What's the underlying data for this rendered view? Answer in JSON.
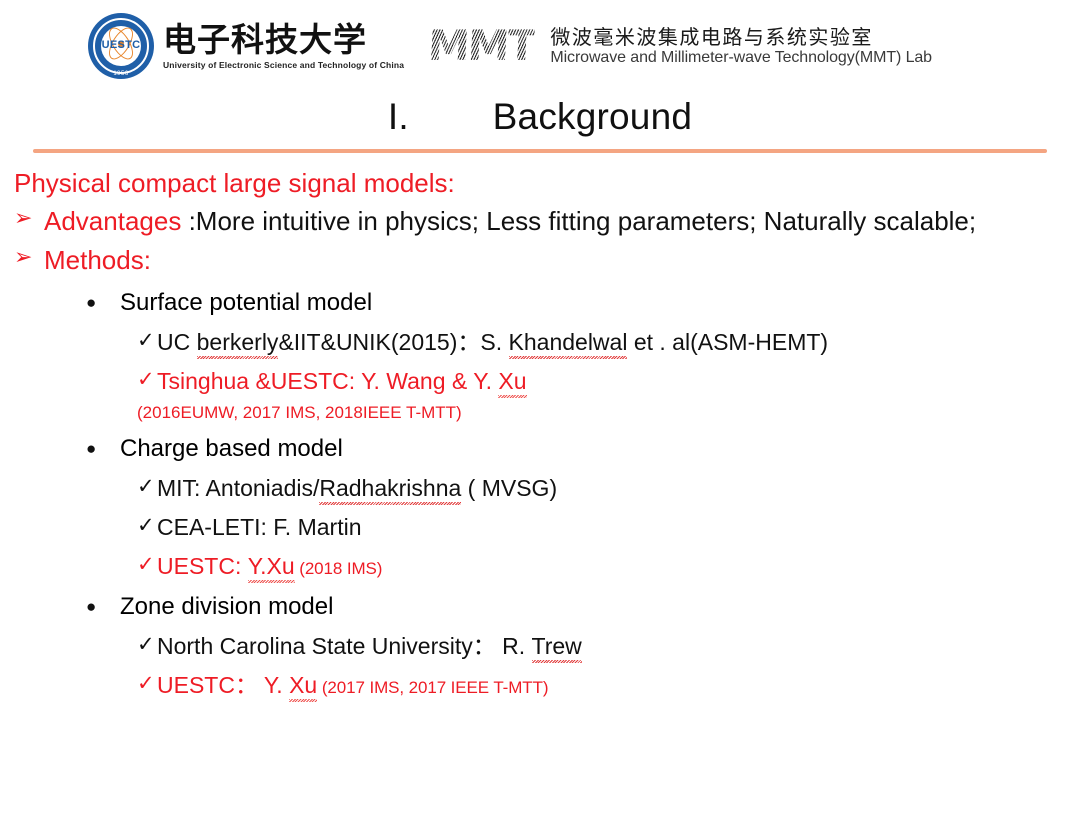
{
  "header": {
    "logo": {
      "seal_text": "UESTC",
      "seal_year": "1956"
    },
    "university_cn": "电子科技大学",
    "university_en": "University of Electronic Science and Technology of China",
    "mmt_mark": "MMT",
    "lab_cn": "微波毫米波集成电路与系统实验室",
    "lab_en": "Microwave and Millimeter-wave Technology(MMT) Lab"
  },
  "title": "I.        Background",
  "colors": {
    "accent_red": "#ee1c25",
    "divider_orange": "#f4a582",
    "seal_blue": "#1f5fa8",
    "body_black": "#111111"
  },
  "body": {
    "lead": "Physical compact large signal models:",
    "arrow_glyph": "➢",
    "disc_glyph": "●",
    "check_glyph": "✓",
    "advantages": {
      "label": "Advantages ",
      "text": ":More intuitive in physics; Less fitting parameters; Naturally scalable;"
    },
    "methods_label": "Methods:",
    "groups": [
      {
        "title": "Surface potential model",
        "items": [
          {
            "color": "black",
            "prefix": "UC ",
            "squiggle1": "berkerly",
            "mid": "&IIT&UNIK(2015)：S. ",
            "squiggle2": "Khandelwal",
            "suffix": "  et . al(ASM-HEMT)"
          },
          {
            "color": "red",
            "prefix": "Tsinghua &UESTC: Y. Wang & Y. ",
            "squiggle1": "Xu",
            "mid": "",
            "squiggle2": "",
            "suffix": ""
          }
        ],
        "sub_ref": "(2016EUMW, 2017 IMS, 2018IEEE T-MTT)"
      },
      {
        "title": "Charge based model",
        "items": [
          {
            "color": "black",
            "prefix": "MIT: Antoniadis/",
            "squiggle1": "Radhakrishna",
            "mid": "",
            "squiggle2": "",
            "suffix": " ( MVSG)"
          },
          {
            "color": "black",
            "prefix": "CEA-LETI: F. Martin",
            "squiggle1": "",
            "mid": "",
            "squiggle2": "",
            "suffix": ""
          },
          {
            "color": "red",
            "prefix": "UESTC: ",
            "squiggle1": "Y.Xu",
            "mid": "",
            "squiggle2": "",
            "suffix": "",
            "small_ref": " (2018 IMS)"
          }
        ],
        "sub_ref": ""
      },
      {
        "title": "Zone division model",
        "items": [
          {
            "color": "black",
            "prefix": "North Carolina State University：  R. ",
            "squiggle1": "Trew",
            "mid": "",
            "squiggle2": "",
            "suffix": ""
          },
          {
            "color": "red",
            "prefix": "UESTC：  Y. ",
            "squiggle1": "Xu",
            "mid": "",
            "squiggle2": "",
            "suffix": "",
            "small_ref": " (2017 IMS, 2017 IEEE T-MTT)"
          }
        ],
        "sub_ref": ""
      }
    ]
  }
}
